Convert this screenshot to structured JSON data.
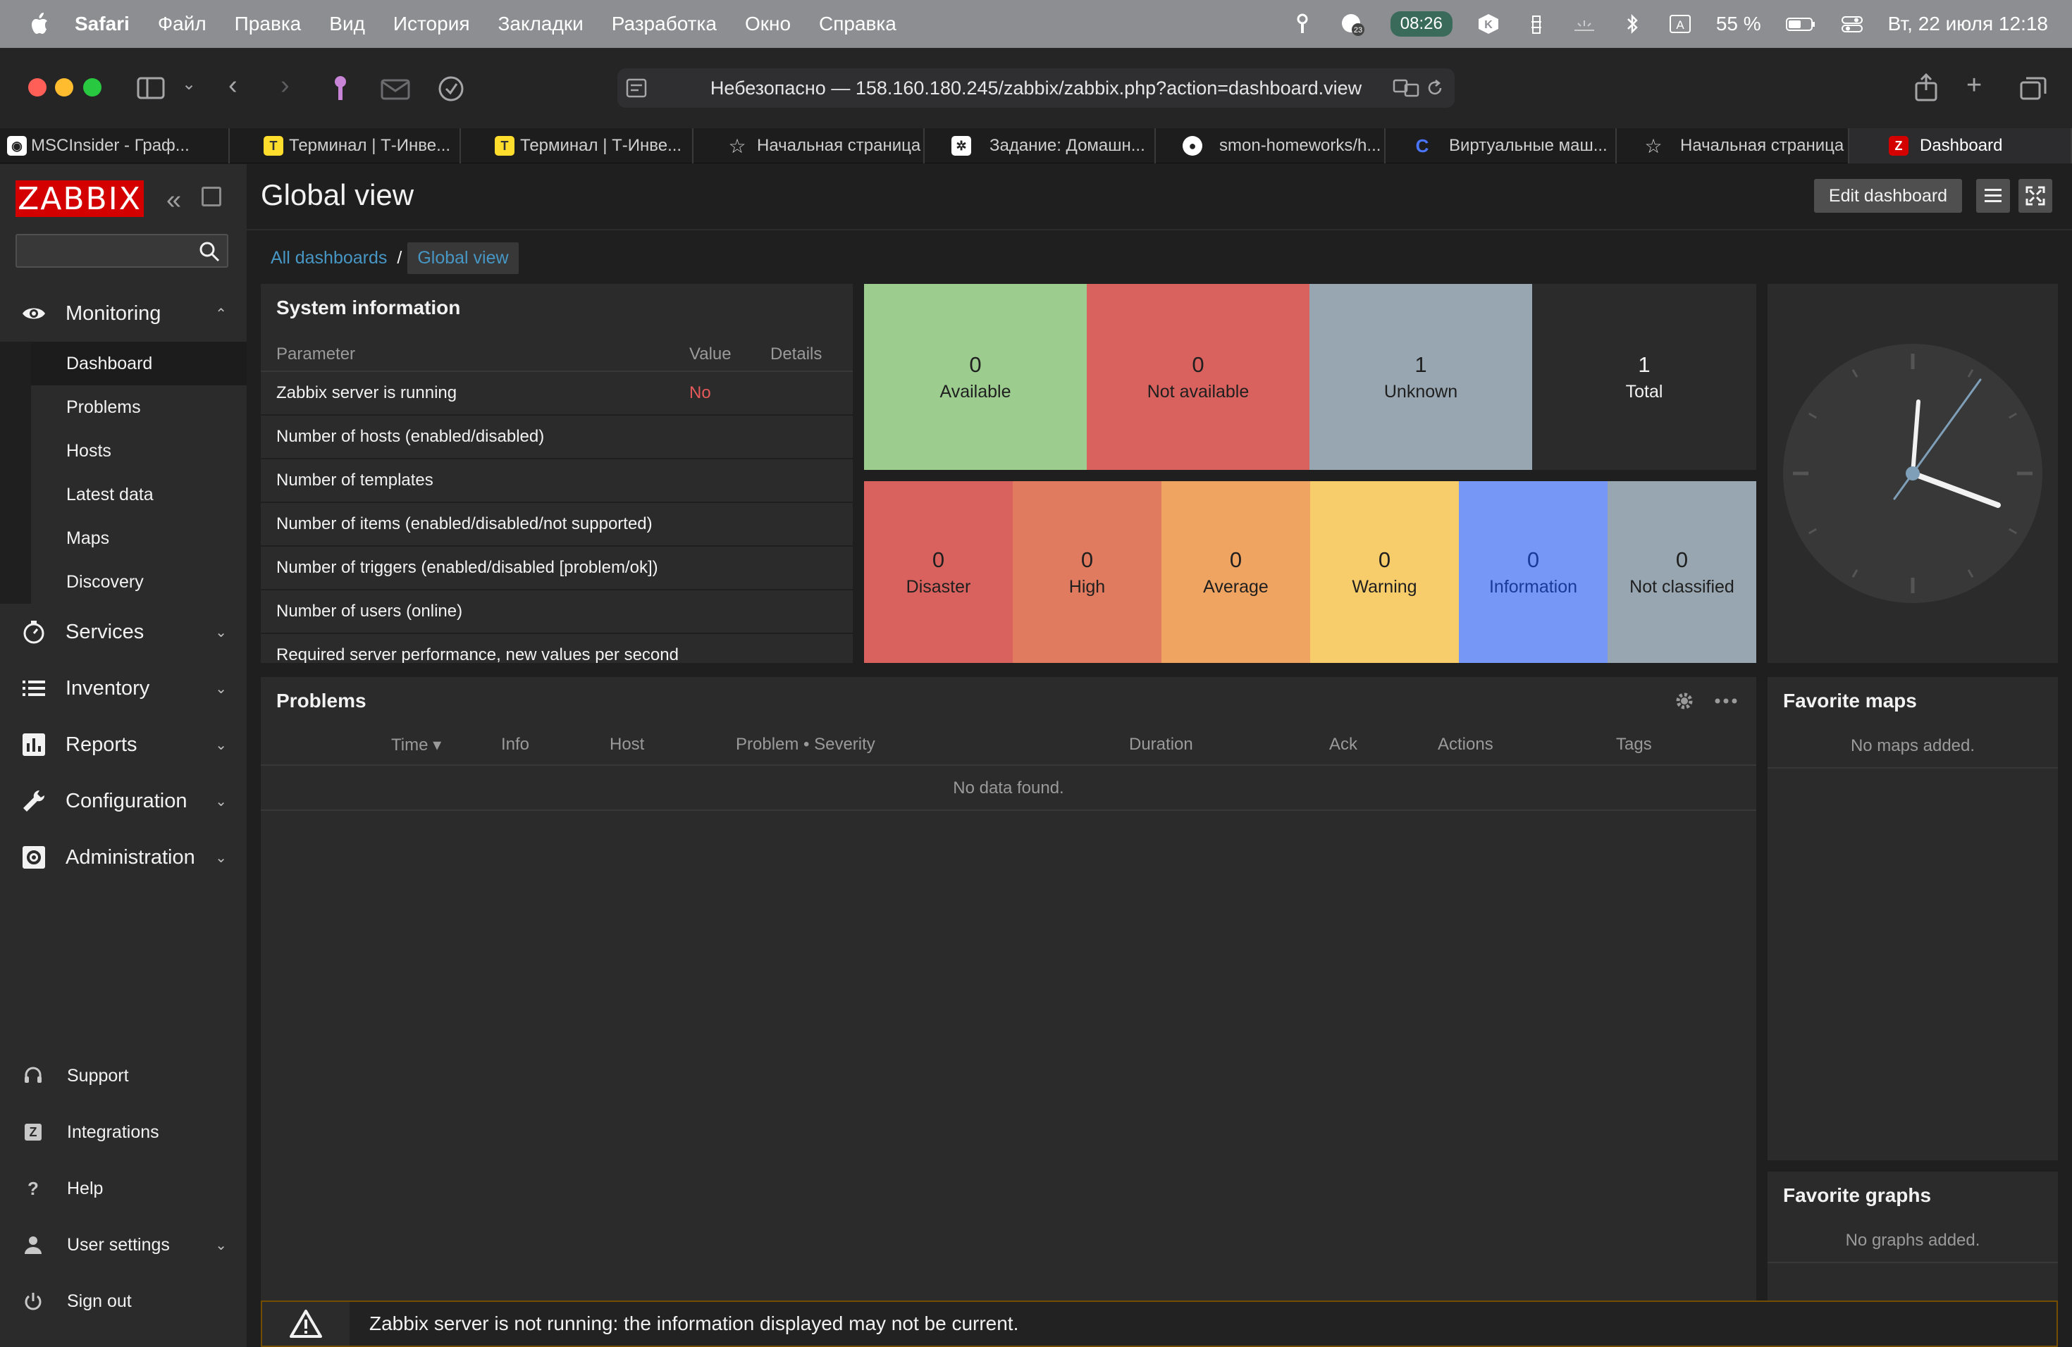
{
  "menubar": {
    "app": "Safari",
    "items": [
      "Файл",
      "Правка",
      "Вид",
      "История",
      "Закладки",
      "Разработка",
      "Окно",
      "Справка"
    ],
    "status_time_pill": "08:26",
    "notification_count": "23",
    "battery": "55 %",
    "datetime": "Вт, 22 июля  12:18"
  },
  "browser": {
    "url": "Небезопасно — 158.160.180.245/zabbix/zabbix.php?action=dashboard.view",
    "tabs": [
      {
        "label": "MSCInsider - Граф...",
        "icon": "mscinsider-icon"
      },
      {
        "label": "Терминал | Т-Инве...",
        "icon": "t-bank-icon"
      },
      {
        "label": "Терминал | Т-Инве...",
        "icon": "t-bank-icon"
      },
      {
        "label": "Начальная страница",
        "icon": "star-icon"
      },
      {
        "label": "Задание: Домашн...",
        "icon": "netology-icon"
      },
      {
        "label": "smon-homeworks/h...",
        "icon": "github-icon"
      },
      {
        "label": "Виртуальные маш...",
        "icon": "yandex-cloud-icon"
      },
      {
        "label": "Начальная страница",
        "icon": "star-icon"
      },
      {
        "label": "Dashboard",
        "icon": "zabbix-icon",
        "active": true
      }
    ]
  },
  "sidebar": {
    "logo": "ZABBIX",
    "search_value": "",
    "monitoring": {
      "label": "Monitoring",
      "items": [
        "Dashboard",
        "Problems",
        "Hosts",
        "Latest data",
        "Maps",
        "Discovery"
      ]
    },
    "sections": [
      "Services",
      "Inventory",
      "Reports",
      "Configuration",
      "Administration"
    ],
    "bottom": [
      "Support",
      "Integrations",
      "Help",
      "User settings",
      "Sign out"
    ],
    "help_glyph": "?",
    "integrations_glyph": "Z"
  },
  "header": {
    "title": "Global view",
    "edit_label": "Edit dashboard",
    "breadcrumb_all": "All dashboards",
    "breadcrumb_sep": "/",
    "breadcrumb_current": "Global view"
  },
  "system_info": {
    "title": "System information",
    "columns": [
      "Parameter",
      "Value",
      "Details"
    ],
    "rows": [
      {
        "param": "Zabbix server is running",
        "value": "No"
      },
      {
        "param": "Number of hosts (enabled/disabled)",
        "value": ""
      },
      {
        "param": "Number of templates",
        "value": ""
      },
      {
        "param": "Number of items (enabled/disabled/not supported)",
        "value": ""
      },
      {
        "param": "Number of triggers (enabled/disabled [problem/ok])",
        "value": ""
      },
      {
        "param": "Number of users (online)",
        "value": ""
      },
      {
        "param": "Required server performance, new values per second",
        "value": ""
      }
    ]
  },
  "host_availability": [
    {
      "count": "0",
      "label": "Available",
      "color": "#9ccd8f"
    },
    {
      "count": "0",
      "label": "Not available",
      "color": "#d9625e"
    },
    {
      "count": "1",
      "label": "Unknown",
      "color": "#97a6b0"
    },
    {
      "count": "1",
      "label": "Total",
      "color": "#2b2b2b"
    }
  ],
  "problems_by_severity": [
    {
      "count": "0",
      "label": "Disaster",
      "color": "#d9625e"
    },
    {
      "count": "0",
      "label": "High",
      "color": "#e07b5f"
    },
    {
      "count": "0",
      "label": "Average",
      "color": "#f0a461"
    },
    {
      "count": "0",
      "label": "Warning",
      "color": "#f7cc6a"
    },
    {
      "count": "0",
      "label": "Information",
      "color": "#7697f5"
    },
    {
      "count": "0",
      "label": "Not classified",
      "color": "#97a6b0"
    }
  ],
  "problems": {
    "title": "Problems",
    "columns": [
      "Time ▾",
      "Info",
      "Host",
      "Problem • Severity",
      "Duration",
      "Ack",
      "Actions",
      "Tags"
    ],
    "empty": "No data found."
  },
  "favorite_maps": {
    "title": "Favorite maps",
    "empty": "No maps added."
  },
  "favorite_graphs": {
    "title": "Favorite graphs",
    "empty": "No graphs added."
  },
  "warning": {
    "text": "Zabbix server is not running: the information displayed may not be current."
  }
}
